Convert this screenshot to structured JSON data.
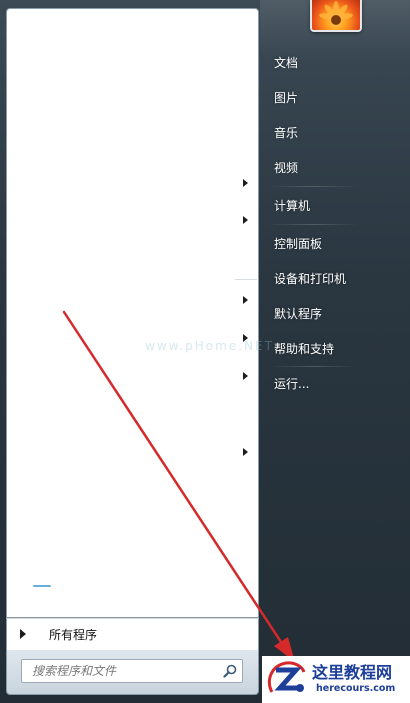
{
  "right_pane": {
    "items": [
      {
        "label": "文档"
      },
      {
        "label": "图片"
      },
      {
        "label": "音乐"
      },
      {
        "label": "视频"
      },
      {
        "label": "计算机"
      },
      {
        "label": "控制面板"
      },
      {
        "label": "设备和打印机"
      },
      {
        "label": "默认程序"
      },
      {
        "label": "帮助和支持"
      },
      {
        "label": "运行..."
      }
    ]
  },
  "left_pane": {
    "all_programs_label": "所有程序",
    "watermark": "www.pHome.NET"
  },
  "search": {
    "placeholder": "搜索程序和文件"
  },
  "logo": {
    "title": "这里教程网",
    "url": "herecours.com"
  },
  "colors": {
    "annotation_arrow": "#d42a2a",
    "logo_blue": "#1d3f9a",
    "logo_red": "#d62828"
  },
  "icons": {
    "avatar": "flower-avatar",
    "search": "magnifier-icon",
    "submenu": "triangle-right-icon"
  }
}
